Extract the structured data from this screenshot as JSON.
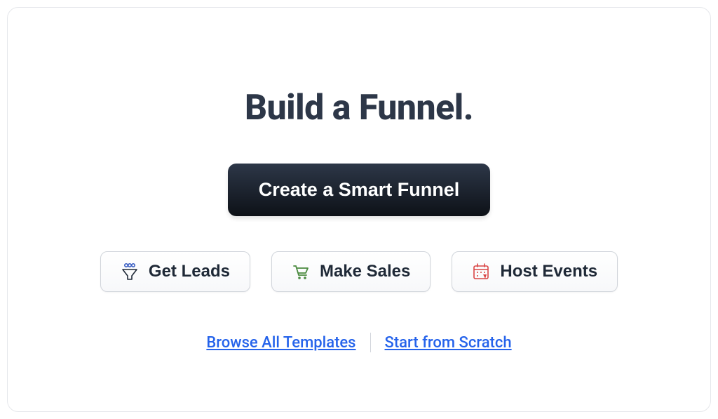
{
  "heading": "Build a Funnel.",
  "primary_button": {
    "label": "Create a Smart Funnel"
  },
  "secondary_buttons": [
    {
      "label": "Get Leads",
      "icon": "funnel-people-icon"
    },
    {
      "label": "Make Sales",
      "icon": "shopping-cart-icon"
    },
    {
      "label": "Host Events",
      "icon": "calendar-icon"
    }
  ],
  "links": {
    "browse_templates": "Browse All Templates",
    "start_scratch": "Start from Scratch"
  }
}
